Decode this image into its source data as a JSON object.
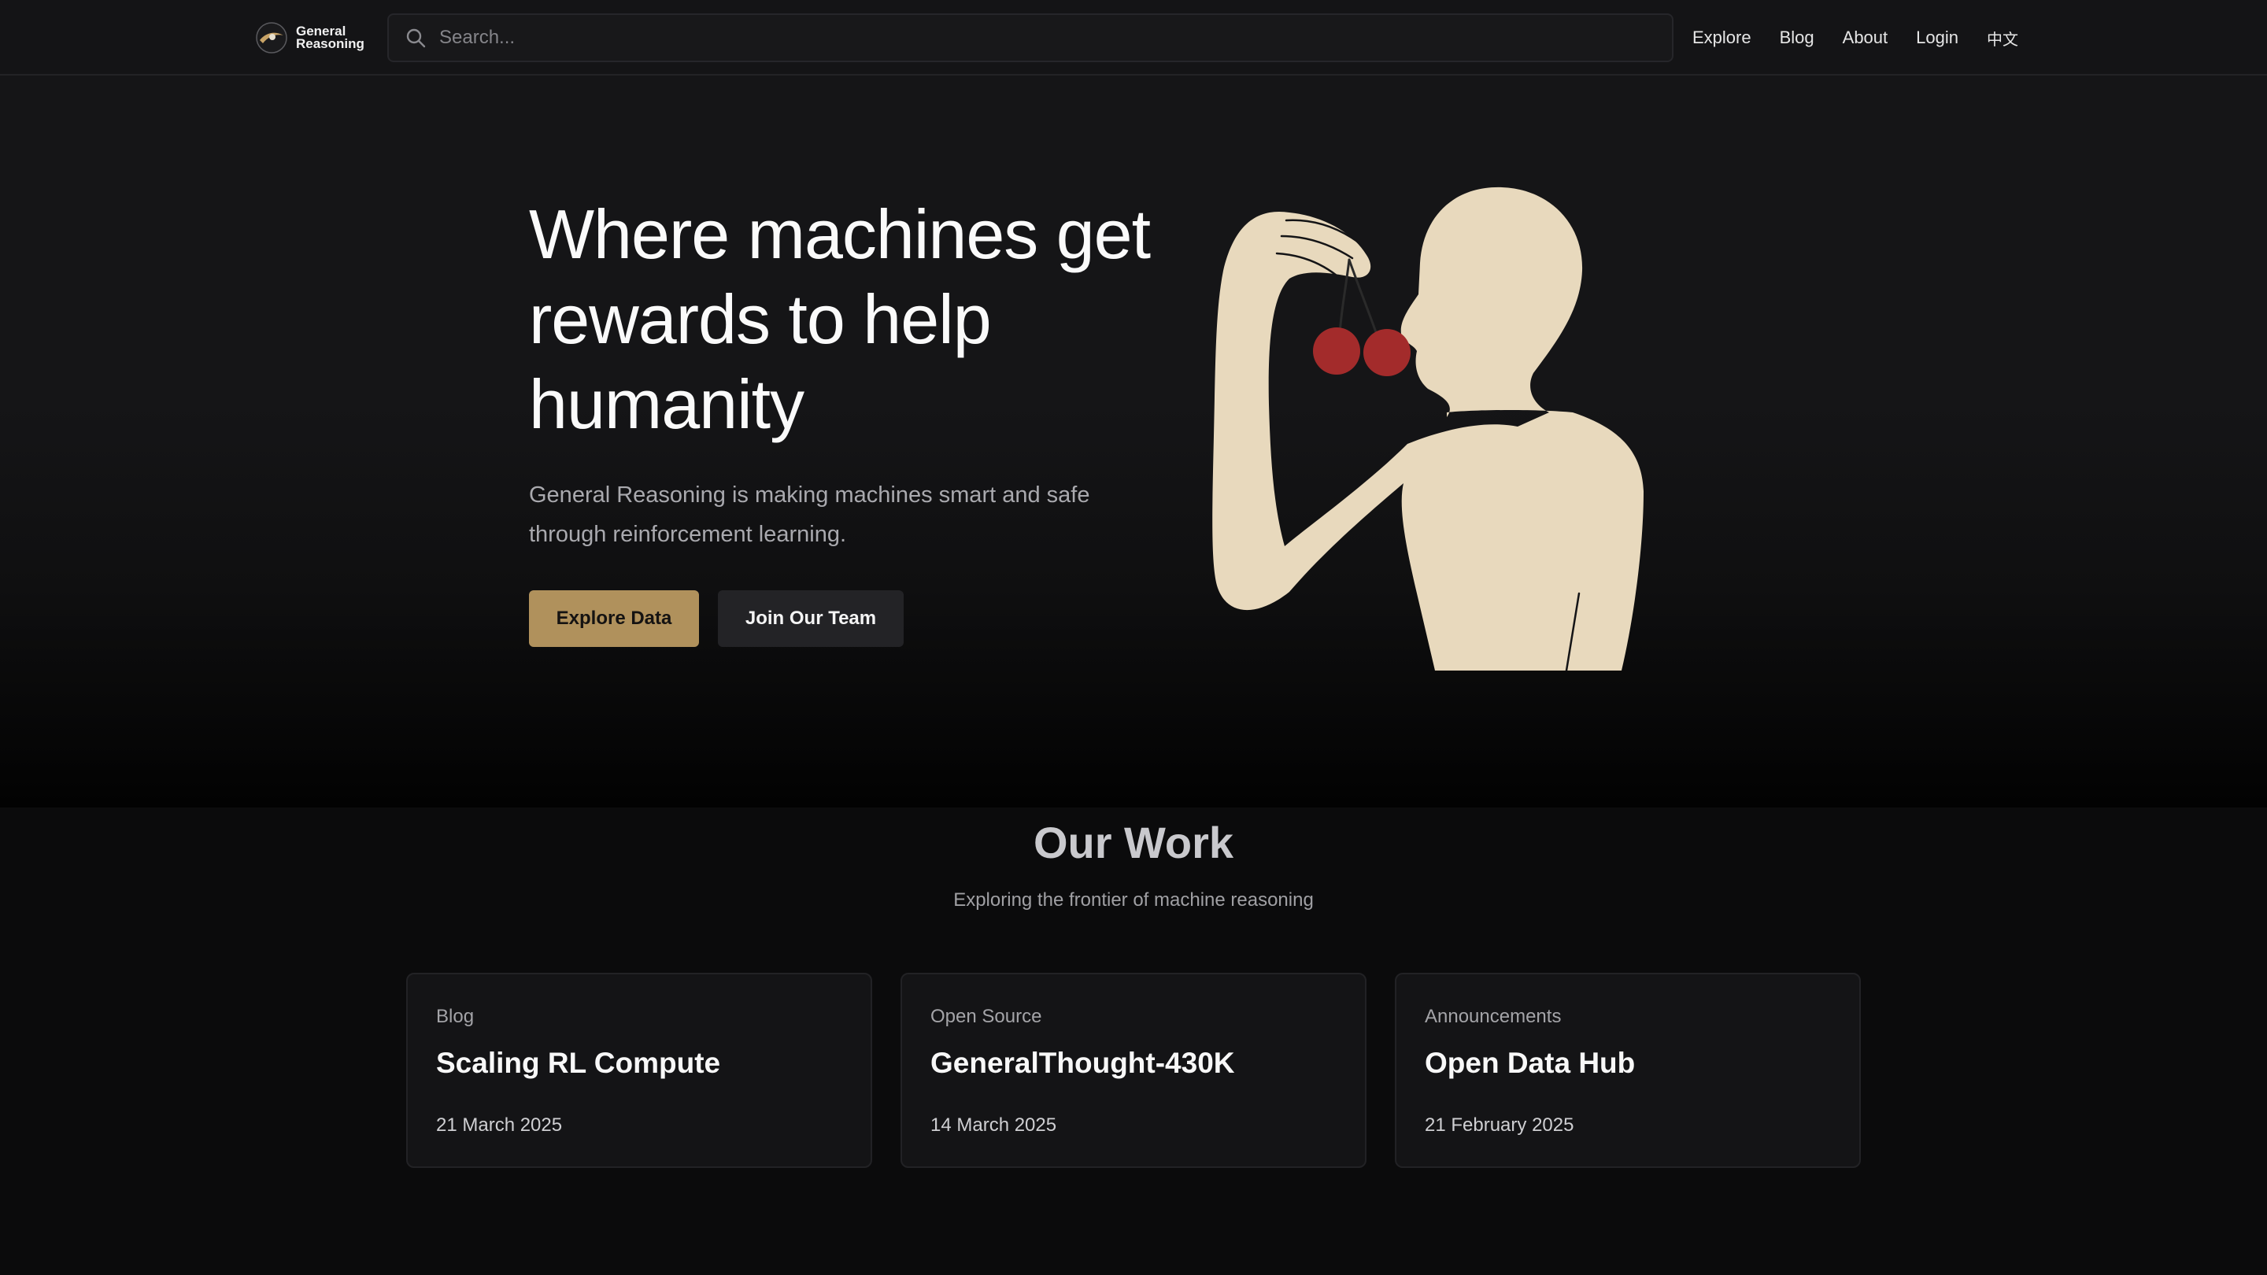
{
  "brand": {
    "line1": "General",
    "line2": "Reasoning"
  },
  "search": {
    "placeholder": "Search..."
  },
  "nav": {
    "explore": "Explore",
    "blog": "Blog",
    "about": "About",
    "login": "Login",
    "language": "中文"
  },
  "hero": {
    "title": "Where machines get rewards to help humanity",
    "subtitle": "General Reasoning is making machines smart and safe through reinforcement learning.",
    "primary_button": "Explore Data",
    "secondary_button": "Join Our Team"
  },
  "work": {
    "title": "Our Work",
    "subtitle": "Exploring the frontier of machine reasoning",
    "cards": [
      {
        "category": "Blog",
        "title": "Scaling RL Compute",
        "date": "21 March 2025"
      },
      {
        "category": "Open Source",
        "title": "GeneralThought-430K",
        "date": "14 March 2025"
      },
      {
        "category": "Announcements",
        "title": "Open Data Hub",
        "date": "21 February 2025"
      }
    ]
  },
  "colors": {
    "accent": "#b0915c",
    "illustration_skin": "#e8d9bd",
    "cherry": "#a32b2b",
    "background": "#0b0b0c"
  }
}
